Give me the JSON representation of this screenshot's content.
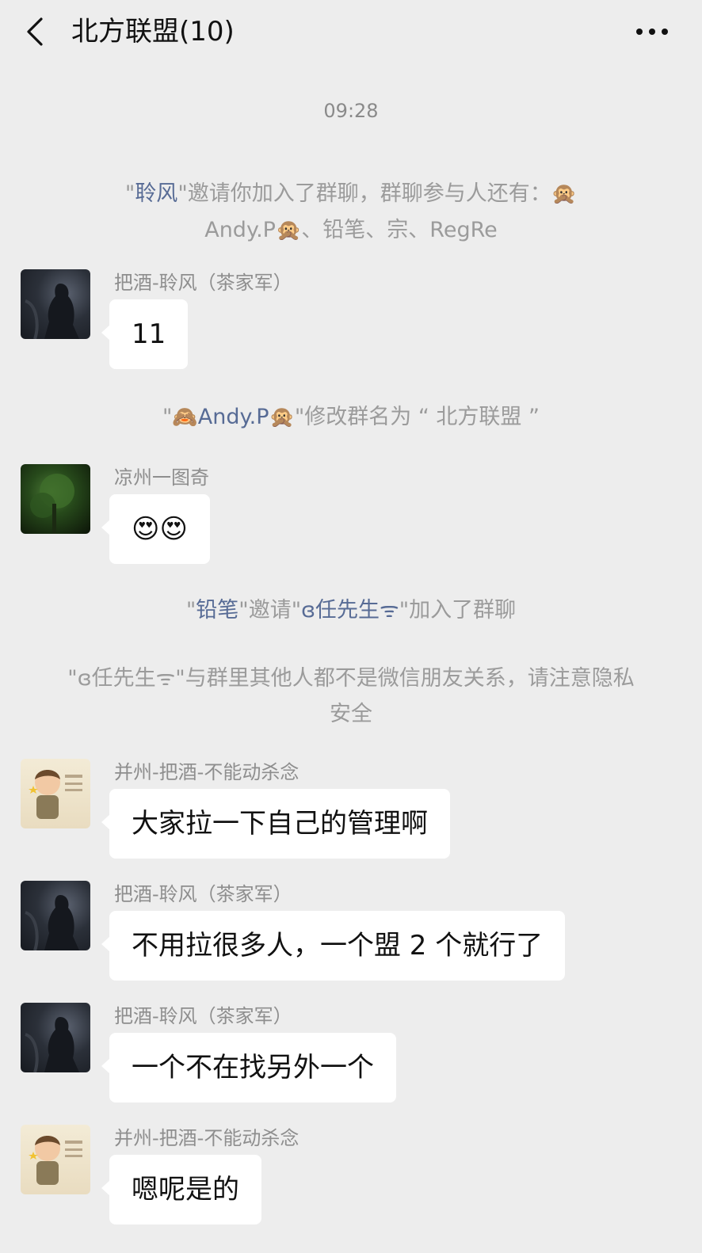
{
  "header": {
    "title": "北方联盟(10)",
    "back_icon": "chevron-left-icon",
    "more_icon": "more-dots-icon"
  },
  "chat": {
    "time": "09:28",
    "system": {
      "invite": {
        "inviter": "聆风",
        "text_a": "邀请你加入了群聊，群聊参与人还有：",
        "name1_emoji": "🙊",
        "name1": "Andy.P",
        "name1_emoji2": "🙊",
        "rest": "、铅笔、宗、RegRe"
      },
      "rename": {
        "emoji_before": "🙈",
        "name": "Andy.P",
        "emoji_after": "🙊",
        "text": "修改群名为 “ 北方联盟 ”"
      },
      "invite2": {
        "inviter": "铅笔",
        "text_mid": "邀请",
        "invitee": "ɞ任先生ᯤ",
        "text_end": "加入了群聊"
      },
      "privacy": {
        "name": "ɞ任先生ᯤ",
        "text": "与群里其他人都不是微信朋友关系，请注意隐私安全"
      }
    },
    "messages": [
      {
        "sender": "把酒-聆风（茶家军）",
        "text": "11"
      },
      {
        "sender": "凉州一图奇",
        "text": "😍😍"
      },
      {
        "sender": "并州-把酒-不能动杀念",
        "text": "大家拉一下自己的管理啊"
      },
      {
        "sender": "把酒-聆风（茶家军）",
        "text": "不用拉很多人，一个盟 2 个就行了"
      },
      {
        "sender": "把酒-聆风（茶家军）",
        "text": "一个不在找另外一个"
      },
      {
        "sender": "并州-把酒-不能动杀念",
        "text": "嗯呢是的"
      }
    ]
  }
}
